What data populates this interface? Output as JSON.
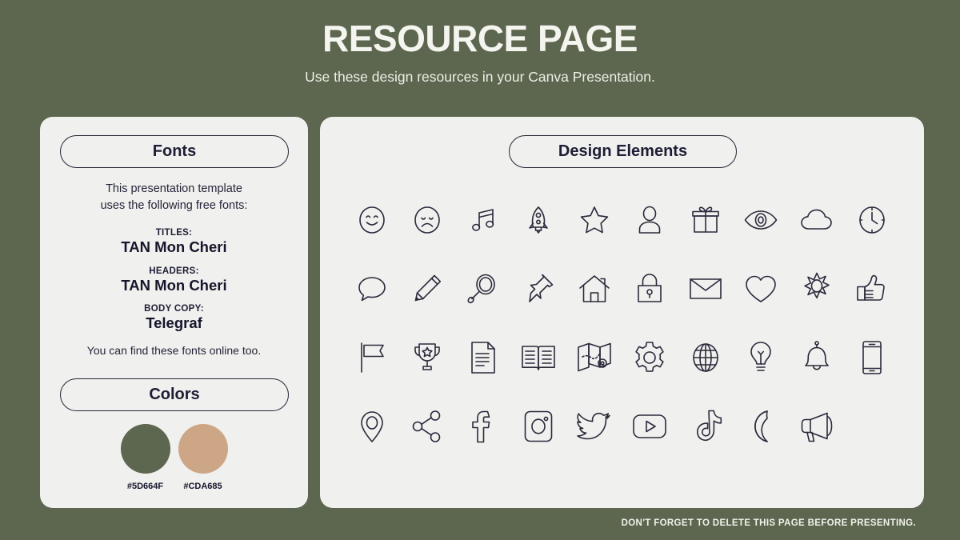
{
  "header": {
    "title": "RESOURCE PAGE",
    "subtitle": "Use these design resources in your Canva Presentation."
  },
  "fonts_card": {
    "pill_label": "Fonts",
    "intro_line_1": "This presentation template",
    "intro_line_2": "uses the following free fonts:",
    "font_roles": [
      {
        "role": "TITLES:",
        "name": "TAN Mon Cheri"
      },
      {
        "role": "HEADERS:",
        "name": "TAN Mon Cheri"
      },
      {
        "role": "BODY COPY:",
        "name": "Telegraf"
      }
    ],
    "outro": "You can find these fonts online too."
  },
  "colors_section": {
    "pill_label": "Colors",
    "swatches": [
      {
        "hex": "#5D664F",
        "label": "#5D664F"
      },
      {
        "hex": "#CDA685",
        "label": "#CDA685"
      }
    ]
  },
  "elements_card": {
    "pill_label": "Design Elements",
    "icons": [
      "smiley-face-icon",
      "sad-face-icon",
      "music-note-icon",
      "rocket-icon",
      "star-icon",
      "person-icon",
      "gift-icon",
      "eye-icon",
      "cloud-icon",
      "clock-icon",
      "speech-bubble-icon",
      "pencil-icon",
      "magnifier-icon",
      "pushpin-icon",
      "house-icon",
      "lock-icon",
      "envelope-icon",
      "heart-icon",
      "sun-icon",
      "thumbs-up-icon",
      "flag-icon",
      "trophy-icon",
      "document-icon",
      "book-icon",
      "map-icon",
      "gear-icon",
      "globe-icon",
      "lightbulb-icon",
      "bell-icon",
      "phone-icon",
      "location-pin-icon",
      "share-icon",
      "facebook-icon",
      "instagram-icon",
      "twitter-icon",
      "youtube-icon",
      "tiktok-icon",
      "moon-icon",
      "megaphone-icon"
    ]
  },
  "footer": {
    "note": "DON'T FORGET TO DELETE THIS PAGE BEFORE PRESENTING."
  },
  "theme": {
    "background": "#5D664F",
    "card_background": "#F0F0EE",
    "ink": "#1D1D35",
    "title_color": "#F4F5EF"
  }
}
